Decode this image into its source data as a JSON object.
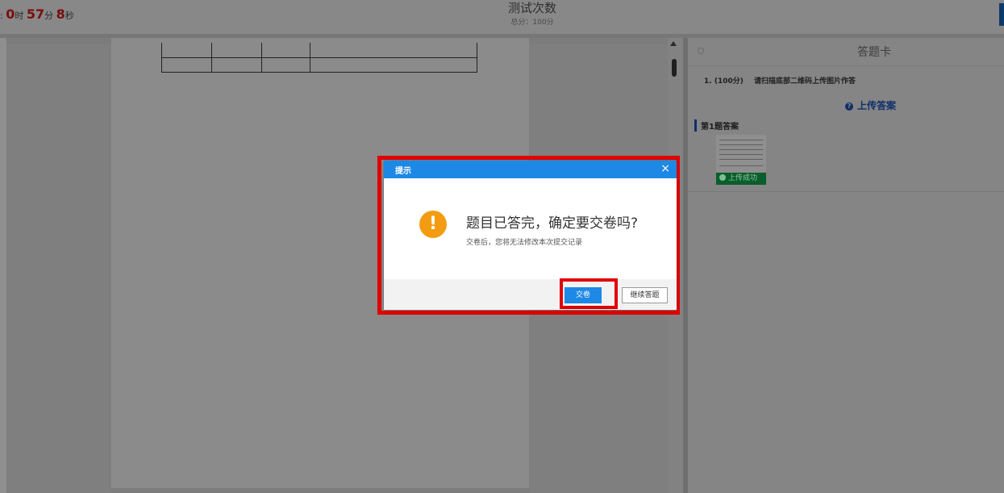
{
  "header": {
    "timer_prefix": ":",
    "hours": "0",
    "hours_unit": "时",
    "minutes": "57",
    "minutes_unit": "分",
    "seconds": "8",
    "seconds_unit": "秒",
    "title": "测试次数",
    "score": "总分：100分"
  },
  "answer_card": {
    "title": "答题卡",
    "question_number": "1.",
    "question_score": "(100分)",
    "question_text": "请扫描底部二维码上传图片作答",
    "upload_label": "上传答案",
    "answer_section_label": "第1题答案",
    "upload_status": "上传成功"
  },
  "modal": {
    "title": "提示",
    "close_glyph": "×",
    "message": "题目已答完，确定要交卷吗?",
    "sub_message": "交卷后，您将无法修改本次提交记录",
    "submit_label": "交卷",
    "continue_label": "继续答题"
  },
  "colors": {
    "primary_blue": "#1e88e5",
    "warning_orange": "#f39c12",
    "highlight_red": "#e00000",
    "success_green": "#0b5d2c"
  }
}
